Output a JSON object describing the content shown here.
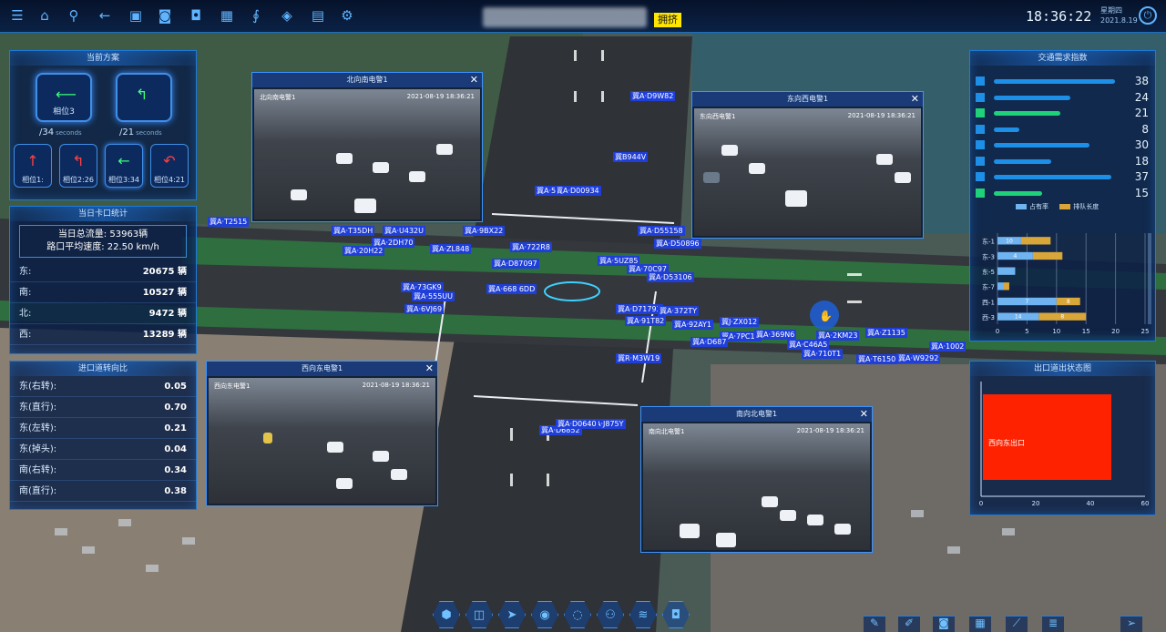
{
  "topbar": {
    "icons": [
      "menu-icon",
      "home-icon",
      "search-icon",
      "back-icon",
      "image-icon",
      "camera-icon",
      "camera-settings-icon",
      "layout-icon",
      "stethoscope-icon",
      "cube-icon",
      "document-icon",
      "settings-icon"
    ],
    "congestion_badge": "拥挤",
    "time": "18:36:22",
    "weekday": "星期四",
    "date": "2021.8.19"
  },
  "signal_panel": {
    "title": "当前方案",
    "phase_main": [
      {
        "label": "相位3",
        "count": "/34",
        "unit": "seconds"
      },
      {
        "label": "",
        "count": "/21",
        "unit": "seconds"
      }
    ],
    "phases": [
      {
        "label": "相位1:",
        "arrow": "↑"
      },
      {
        "label": "相位2:26",
        "arrow": "↰"
      },
      {
        "label": "相位3:34",
        "arrow": "←"
      },
      {
        "label": "相位4:21",
        "arrow": "↶"
      }
    ]
  },
  "checkpoint_panel": {
    "title": "当日卡口统计",
    "total": "当日总流量: 53963辆",
    "avg_speed": "路口平均速度: 22.50 km/h",
    "rows": [
      {
        "dir": "东:",
        "value": "20675 辆"
      },
      {
        "dir": "南:",
        "value": "10527 辆"
      },
      {
        "dir": "北:",
        "value": "9472 辆"
      },
      {
        "dir": "西:",
        "value": "13289 辆"
      }
    ]
  },
  "turn_panel": {
    "title": "进口道转向比",
    "rows": [
      {
        "dir": "东(右转):",
        "value": "0.05"
      },
      {
        "dir": "东(直行):",
        "value": "0.70"
      },
      {
        "dir": "东(左转):",
        "value": "0.21"
      },
      {
        "dir": "东(掉头):",
        "value": "0.04"
      },
      {
        "dir": "南(右转):",
        "value": "0.34"
      },
      {
        "dir": "南(直行):",
        "value": "0.38"
      }
    ]
  },
  "videos": {
    "north": {
      "title": "北向南电警1",
      "caption": "北向南电警1",
      "timestamp": "2021-08-19  18:36:21"
    },
    "east": {
      "title": "东向西电警1",
      "caption": "东向西电警1",
      "timestamp": "2021-08-19  18:36:21"
    },
    "west": {
      "title": "西向东电警1",
      "caption": "西向东电警1",
      "timestamp": "2021-08-19  18:36:21"
    },
    "south": {
      "title": "南向北电警1",
      "caption": "南向北电警1",
      "timestamp": "2021-08-19  18:36:21"
    }
  },
  "plates": [
    "冀A·D9W82",
    "冀B944V",
    "冀A·D00934",
    "冀A·5",
    "冀A·T2515",
    "冀A·9BX22",
    "冀A·D55158",
    "冀A·D50896",
    "冀A·722R8",
    "冀A·5UZ85",
    "冀A·70C97",
    "冀A·D53106",
    "冀A·ZL848",
    "冀A·T35DH",
    "冀A·U432U",
    "冀A·2DH70",
    "冀A·20H22",
    "冀A·D87097",
    "冀A·73GK9",
    "冀A·555UU",
    "冀A·6VJ69",
    "冀A·668 6DD",
    "冀A·D71793",
    "冀A·372TY",
    "冀A·91T82",
    "冀A·92AY1",
    "冀J·ZX012",
    "冀A·7PC10",
    "冀A·369N6",
    "冀A·C46A5",
    "冀A·2KM23",
    "冀A·Z1135",
    "冀A·710T1",
    "冀A·T6150",
    "冀A·W9292",
    "冀A·1002",
    "冀R·M3W19",
    "冀A·D6852",
    "冀A·J875Y",
    "冀A·D687",
    "冀A·D0640"
  ],
  "traffic_index_panel": {
    "title": "交通需求指数",
    "bars": [
      {
        "value": "38",
        "pct": 0.95,
        "color": "#1d8fe6"
      },
      {
        "value": "24",
        "pct": 0.6,
        "color": "#1d8fe6"
      },
      {
        "value": "21",
        "pct": 0.52,
        "color": "#1fd27a"
      },
      {
        "value": "8",
        "pct": 0.2,
        "color": "#1d8fe6"
      },
      {
        "value": "30",
        "pct": 0.75,
        "color": "#1d8fe6"
      },
      {
        "value": "18",
        "pct": 0.45,
        "color": "#1d8fe6"
      },
      {
        "value": "37",
        "pct": 0.92,
        "color": "#1d8fe6"
      },
      {
        "value": "15",
        "pct": 0.38,
        "color": "#1fd27a"
      }
    ],
    "legend": [
      "占有率",
      "排队长度"
    ]
  },
  "chart_data": [
    {
      "type": "bar",
      "orientation": "horizontal",
      "categories": [
        "东-1",
        "东-3",
        "东-5",
        "东-7",
        "西-1",
        "西-3"
      ],
      "series": [
        {
          "name": "占有率",
          "color": "#6fb3f0",
          "values": [
            4,
            6,
            3,
            1,
            10,
            7
          ]
        },
        {
          "name": "排队长度",
          "color": "#d9a63a",
          "values": [
            5,
            5,
            0,
            1,
            4,
            8
          ]
        }
      ],
      "data_labels": [
        "10",
        "4",
        "7",
        "8",
        "14",
        "8"
      ],
      "xlim": [
        0,
        25
      ],
      "xticks": [
        "0",
        "5",
        "10",
        "15",
        "20",
        "25"
      ]
    },
    {
      "type": "heatmap",
      "title": "出口道出状态图",
      "cell_label": "西向东出口",
      "cell_color": "#ff2200",
      "xlim": [
        0,
        60
      ],
      "xticks": [
        "0",
        "20",
        "40",
        "60"
      ]
    }
  ],
  "bottom_toolbar": {
    "icons": [
      "hexagon-icon",
      "car-icon",
      "arrow-icon",
      "traffic-light-icon",
      "signal-icon",
      "people-icon",
      "layers-icon",
      "camera-icon"
    ]
  },
  "br_toolbar": {
    "icons": [
      "pen-icon",
      "edit-icon",
      "camera-icon",
      "calendar-icon",
      "road-icon",
      "stack-icon",
      "send-icon"
    ]
  }
}
